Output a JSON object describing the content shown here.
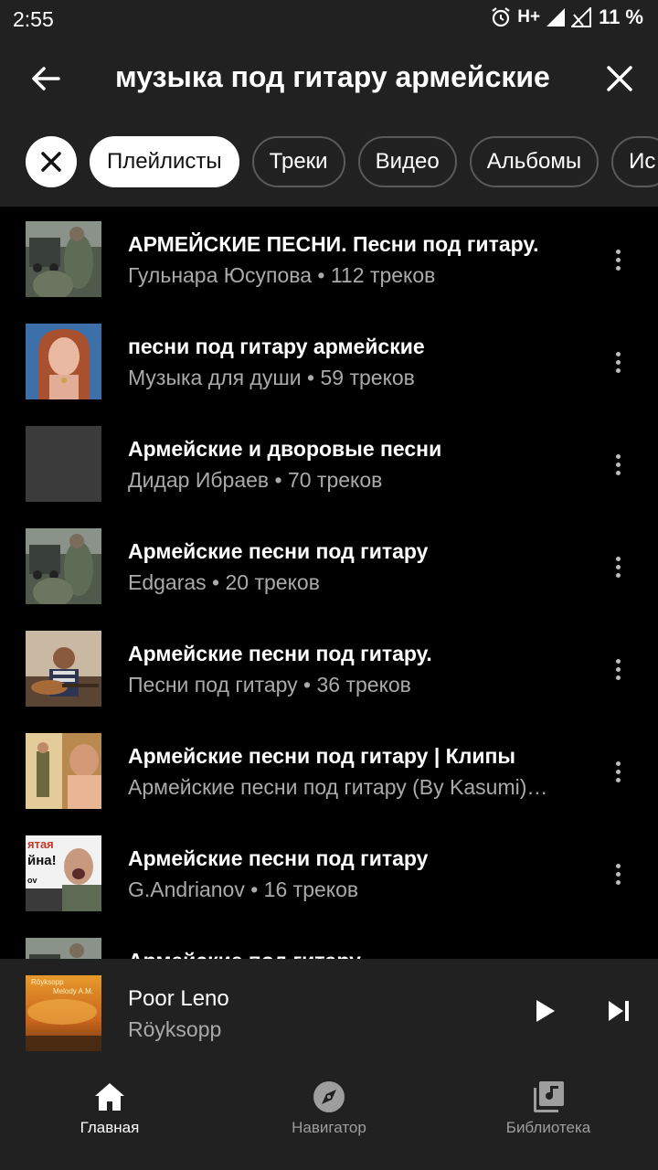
{
  "status_bar": {
    "time": "2:55",
    "network": "H+",
    "battery": "11 %"
  },
  "search": {
    "query": "музыка под гитару армейские"
  },
  "filters": {
    "chips": [
      "Плейлисты",
      "Треки",
      "Видео",
      "Альбомы",
      "Ис"
    ],
    "active": "Плейлисты"
  },
  "results": [
    {
      "title": "АРМЕЙСКИЕ ПЕСНИ. Песни под гитару.",
      "subtitle": "Гульнара Юсупова • 112 треков",
      "thumb": "soldiers"
    },
    {
      "title": "песни под гитару армейские",
      "subtitle": "Музыка для души • 59 треков",
      "thumb": "girl"
    },
    {
      "title": "Армейские и дворовые песни",
      "subtitle": "Дидар Ибраев • 70 треков",
      "thumb": "blank"
    },
    {
      "title": "Армейские песни под гитару",
      "subtitle": "Edgaras • 20 треков",
      "thumb": "soldiers"
    },
    {
      "title": "Армейские песни под гитару.",
      "subtitle": "Песни под гитару • 36 треков",
      "thumb": "guitarist"
    },
    {
      "title": "Армейские песни под гитару | Клипы",
      "subtitle": "Армейские песни под гитару (By Kasumi)…",
      "thumb": "corridor"
    },
    {
      "title": "Армейские песни под гитару",
      "subtitle": "G.Andrianov • 16 треков",
      "thumb": "singer"
    },
    {
      "title": "Армейские под гитару",
      "subtitle": "",
      "thumb": "soldiers"
    }
  ],
  "player": {
    "title": "Poor Leno",
    "artist": "Röyksopp",
    "art_text_top": "Röyksopp",
    "art_text_bottom": "Melody A.M."
  },
  "nav": {
    "items": [
      {
        "label": "Главная",
        "icon": "home-icon",
        "active": true
      },
      {
        "label": "Навигатор",
        "icon": "compass-icon",
        "active": false
      },
      {
        "label": "Библиотека",
        "icon": "library-icon",
        "active": false
      }
    ]
  },
  "thumb_overlay": {
    "singer_text_top": "ятая",
    "singer_text_mid": "йна!",
    "singer_text_low": "ov"
  }
}
